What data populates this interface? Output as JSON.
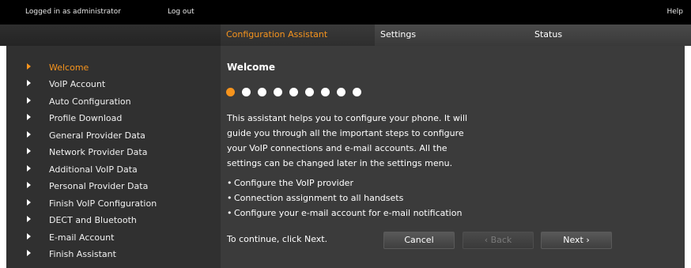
{
  "topbar": {
    "login_text": "Logged in as administrator",
    "logout_label": "Log out",
    "help_label": "Help"
  },
  "tabs": [
    {
      "label": "Configuration Assistant",
      "active": true
    },
    {
      "label": "Settings",
      "active": false
    },
    {
      "label": "Status",
      "active": false
    }
  ],
  "sidebar": {
    "items": [
      {
        "label": "Welcome",
        "active": true
      },
      {
        "label": "VoIP Account",
        "active": false
      },
      {
        "label": "Auto Configuration",
        "active": false
      },
      {
        "label": "Profile Download",
        "active": false
      },
      {
        "label": "General Provider Data",
        "active": false
      },
      {
        "label": "Network Provider Data",
        "active": false
      },
      {
        "label": "Additional VoIP Data",
        "active": false
      },
      {
        "label": "Personal Provider Data",
        "active": false
      },
      {
        "label": "Finish VoIP Configuration",
        "active": false
      },
      {
        "label": "DECT and Bluetooth",
        "active": false
      },
      {
        "label": "E-mail Account",
        "active": false
      },
      {
        "label": "Finish Assistant",
        "active": false
      }
    ]
  },
  "main": {
    "title": "Welcome",
    "progress": {
      "current_step": 1,
      "total_steps": 9
    },
    "intro_lines": [
      "This assistant helps you to configure your phone. It will",
      "guide you through all the important steps to configure",
      "your VoIP connections and e-mail accounts. All the",
      "settings can be changed later in the settings menu."
    ],
    "bullets": [
      "Configure the VoIP provider",
      "Connection assignment to all handsets",
      "Configure your e-mail account for e-mail notification"
    ],
    "continue_text": "To continue, click Next.",
    "buttons": {
      "cancel": "Cancel",
      "back": "‹ Back",
      "next": "Next ›"
    }
  },
  "colors": {
    "accent": "#f7941d",
    "panel_bg": "#3b3b3b",
    "sidebar_bg": "#303030",
    "topbar_bg": "#000000"
  }
}
